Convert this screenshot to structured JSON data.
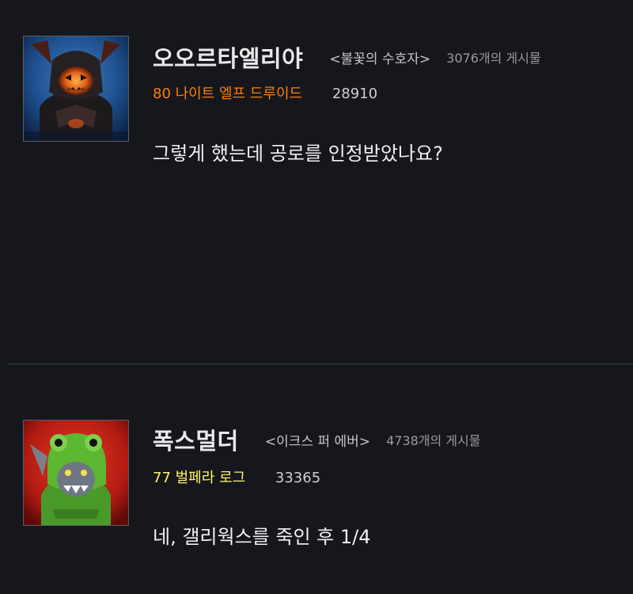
{
  "posts": [
    {
      "author": "오오르타엘리야",
      "title": "<불꽃의 수호자>",
      "post_count": "3076개의 게시물",
      "character": "80 나이트 엘프 드루이드",
      "achievement_points": "28910",
      "body": "그렇게 했는데 공로를 인정받았나요?",
      "class_color": "#ff7d0a"
    },
    {
      "author": "폭스멀더",
      "title": "<이크스 퍼 에버>",
      "post_count": "4738개의 게시물",
      "character": "77 벌페라 로그",
      "achievement_points": "33365",
      "body": "네, 갤리웍스를 죽인 후 1/4",
      "class_color": "#fff569"
    }
  ]
}
